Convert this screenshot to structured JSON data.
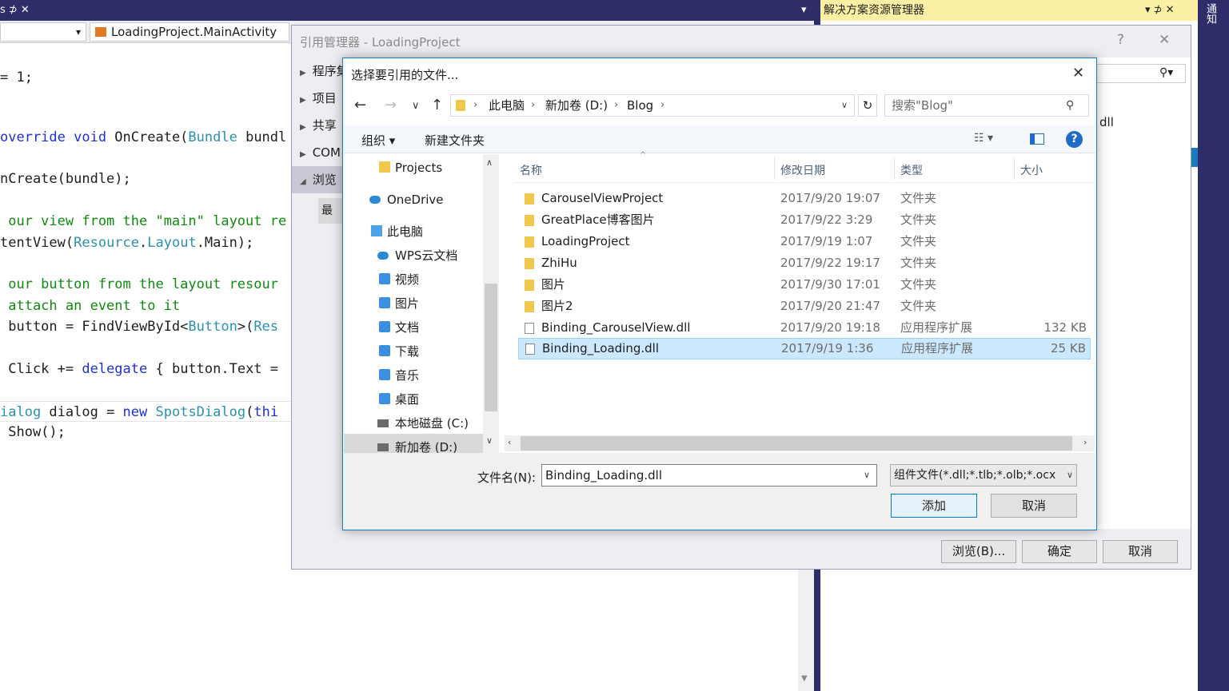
{
  "vs": {
    "tab_chars": "s ⊅ ✕",
    "nav_combo_left_arrow": "▾",
    "nav_combo_main": "LoadingProject.MainActivity",
    "tabbar_dropdown": "▾",
    "code_lines": [
      "= 1;",
      "override void OnCreate(Bundle bundl",
      "nCreate(bundle);",
      " our view from the \"main\" layout re",
      "tentView(Resource.Layout.Main);",
      " our button from the layout resour",
      " attach an event to it",
      " button = FindViewById<Button>(Res",
      " Click += delegate { button.Text =",
      "ialog dialog = new SpotsDialog(thi",
      " Show();"
    ]
  },
  "solution_explorer": {
    "title": "解决方案资源管理器",
    "title_buttons": "▾ ⊅ ✕",
    "side_label": "通知"
  },
  "ref_manager": {
    "title": "引用管理器 - LoadingProject",
    "help": "?",
    "close": "✕",
    "nav": [
      "程序集",
      "项目",
      "共享",
      "COM",
      "浏览"
    ],
    "recent": "最近",
    "dll_partial": "dll",
    "buttons": {
      "browse": "浏览(B)...",
      "ok": "确定",
      "cancel": "取消"
    }
  },
  "file_dialog": {
    "title": "选择要引用的文件...",
    "close": "✕",
    "nav": {
      "back": "←",
      "forward": "→",
      "recent": "∨",
      "up": "↑"
    },
    "breadcrumb": [
      "此电脑",
      "新加卷 (D:)",
      "Blog"
    ],
    "refresh": "↻",
    "search_placeholder": "搜索\"Blog\"",
    "toolbar": {
      "organize": "组织 ▾",
      "new_folder": "新建文件夹",
      "help": "?"
    },
    "tree": [
      "Projects",
      "OneDrive",
      "此电脑",
      "WPS云文档",
      "视频",
      "图片",
      "文档",
      "下载",
      "音乐",
      "桌面",
      "本地磁盘 (C:)",
      "新加卷 (D:)"
    ],
    "columns": {
      "name": "名称",
      "date": "修改日期",
      "type": "类型",
      "size": "大小"
    },
    "files": [
      {
        "name": "CarouselViewProject",
        "date": "2017/9/20 19:07",
        "type": "文件夹",
        "size": "",
        "kind": "folder"
      },
      {
        "name": "GreatPlace博客图片",
        "date": "2017/9/22 3:29",
        "type": "文件夹",
        "size": "",
        "kind": "folder"
      },
      {
        "name": "LoadingProject",
        "date": "2017/9/19 1:07",
        "type": "文件夹",
        "size": "",
        "kind": "folder"
      },
      {
        "name": "ZhiHu",
        "date": "2017/9/22 19:17",
        "type": "文件夹",
        "size": "",
        "kind": "folder"
      },
      {
        "name": "图片",
        "date": "2017/9/30 17:01",
        "type": "文件夹",
        "size": "",
        "kind": "folder"
      },
      {
        "name": "图片2",
        "date": "2017/9/20 21:47",
        "type": "文件夹",
        "size": "",
        "kind": "folder"
      },
      {
        "name": "Binding_CarouselView.dll",
        "date": "2017/9/20 19:18",
        "type": "应用程序扩展",
        "size": "132 KB",
        "kind": "dll"
      },
      {
        "name": "Binding_Loading.dll",
        "date": "2017/9/19 1:36",
        "type": "应用程序扩展",
        "size": "25 KB",
        "kind": "dll",
        "selected": true
      }
    ],
    "filename_label": "文件名(N):",
    "filename_value": "Binding_Loading.dll",
    "filter_value": "组件文件(*.dll;*.tlb;*.olb;*.ocx",
    "buttons": {
      "add": "添加",
      "cancel": "取消"
    }
  },
  "colors": {
    "vs_dark": "#2d2d6a",
    "accent_blue": "#1979ca",
    "selection": "#cce8ff",
    "tool_title_yellow": "#fcf0a4"
  }
}
